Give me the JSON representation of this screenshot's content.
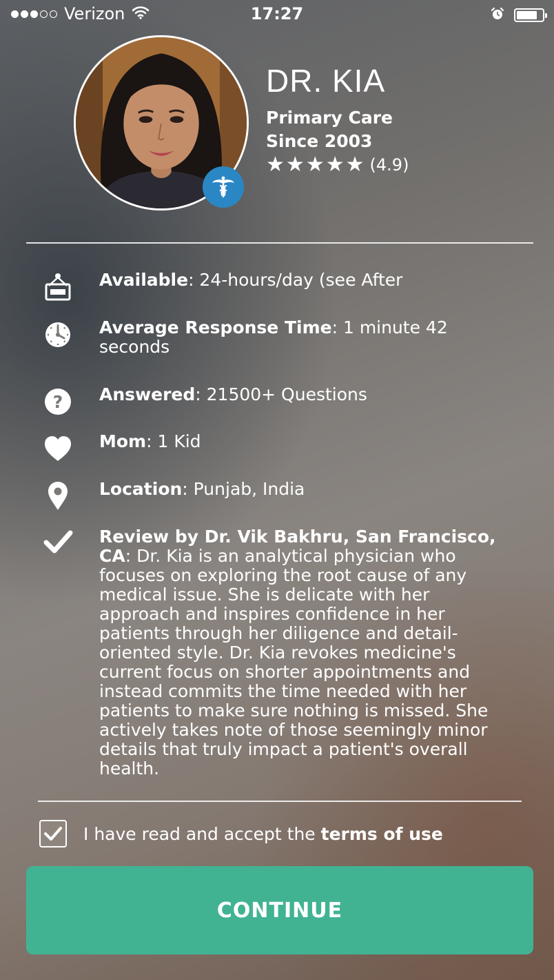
{
  "status_bar": {
    "carrier": "Verizon",
    "time": "17:27",
    "signal_bars": 3,
    "battery_level": 0.8,
    "icons": [
      "wifi-icon",
      "alarm-icon",
      "battery-icon"
    ]
  },
  "doctor": {
    "name": "DR. KIA",
    "specialty": "Primary Care",
    "since": "Since 2003",
    "stars": 5,
    "rating": "(4.9)",
    "badge_icon": "caduceus-icon"
  },
  "details": [
    {
      "icon": "sign-icon",
      "label": "Available",
      "value": ": 24-hours/day (see After"
    },
    {
      "icon": "clock-icon",
      "label": "Average Response Time",
      "value": ": 1 minute 42 seconds"
    },
    {
      "icon": "question-icon",
      "label": "Answered",
      "value": ": 21500+ Questions"
    },
    {
      "icon": "heart-icon",
      "label": "Mom",
      "value": ": 1 Kid"
    },
    {
      "icon": "location-pin-icon",
      "label": "Location",
      "value": ": Punjab, India"
    },
    {
      "icon": "checkmark-icon",
      "label": "Review by Dr. Vik Bakhru, San Francisco, CA",
      "value": ": Dr. Kia is an analytical physician who focuses on exploring the root cause of any medical issue. She is delicate with her approach and inspires confidence in her patients through her diligence and detail-oriented style. Dr. Kia revokes medicine's current focus on shorter appointments and instead commits the time needed with her patients to make sure nothing is missed. She actively takes note of those seemingly minor details that truly impact a patient's overall health."
    }
  ],
  "terms": {
    "prefix": "I have read and accept the ",
    "link": "terms of use",
    "checked": true
  },
  "continue_label": "CONTINUE",
  "colors": {
    "accent_green": "#41b393",
    "badge_blue": "#2b86c4"
  }
}
